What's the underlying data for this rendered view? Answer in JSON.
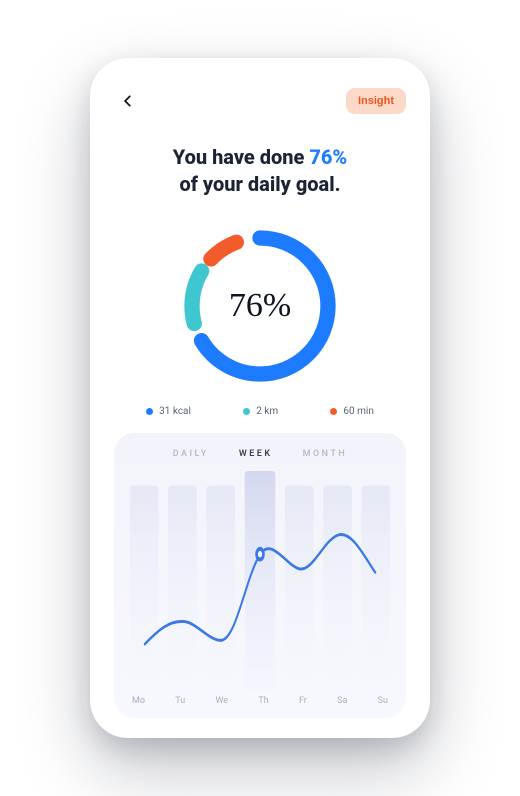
{
  "header": {
    "insight_label": "Insight"
  },
  "headline": {
    "prefix": "You have done ",
    "percent": "76%",
    "suffix_line1": "",
    "line2": "of your daily goal."
  },
  "donut": {
    "center_label": "76%"
  },
  "legend": {
    "items": [
      {
        "name": "kcal",
        "label": "31 kcal",
        "color": "#1d7bff"
      },
      {
        "name": "km",
        "label": "2 km",
        "color": "#3fc7cf"
      },
      {
        "name": "min",
        "label": "60 min",
        "color": "#f25b2a"
      }
    ]
  },
  "chart": {
    "tabs": {
      "daily": "DAILY",
      "week": "WEEK",
      "month": "MONTH",
      "active": "week"
    },
    "xaxis": [
      "Mo",
      "Tu",
      "We",
      "Th",
      "Fr",
      "Sa",
      "Su"
    ]
  },
  "chart_data": {
    "type": "line",
    "categories": [
      "Mo",
      "Tu",
      "We",
      "Th",
      "Fr",
      "Sa",
      "Su"
    ],
    "values": [
      20,
      32,
      22,
      68,
      60,
      78,
      58
    ],
    "title": "",
    "xlabel": "",
    "ylabel": "",
    "ylim": [
      0,
      100
    ],
    "highlight_index": 3
  },
  "colors": {
    "accent_blue": "#1d7bff",
    "teal": "#3fc7cf",
    "orange": "#f25b2a",
    "ink": "#1c2433"
  }
}
